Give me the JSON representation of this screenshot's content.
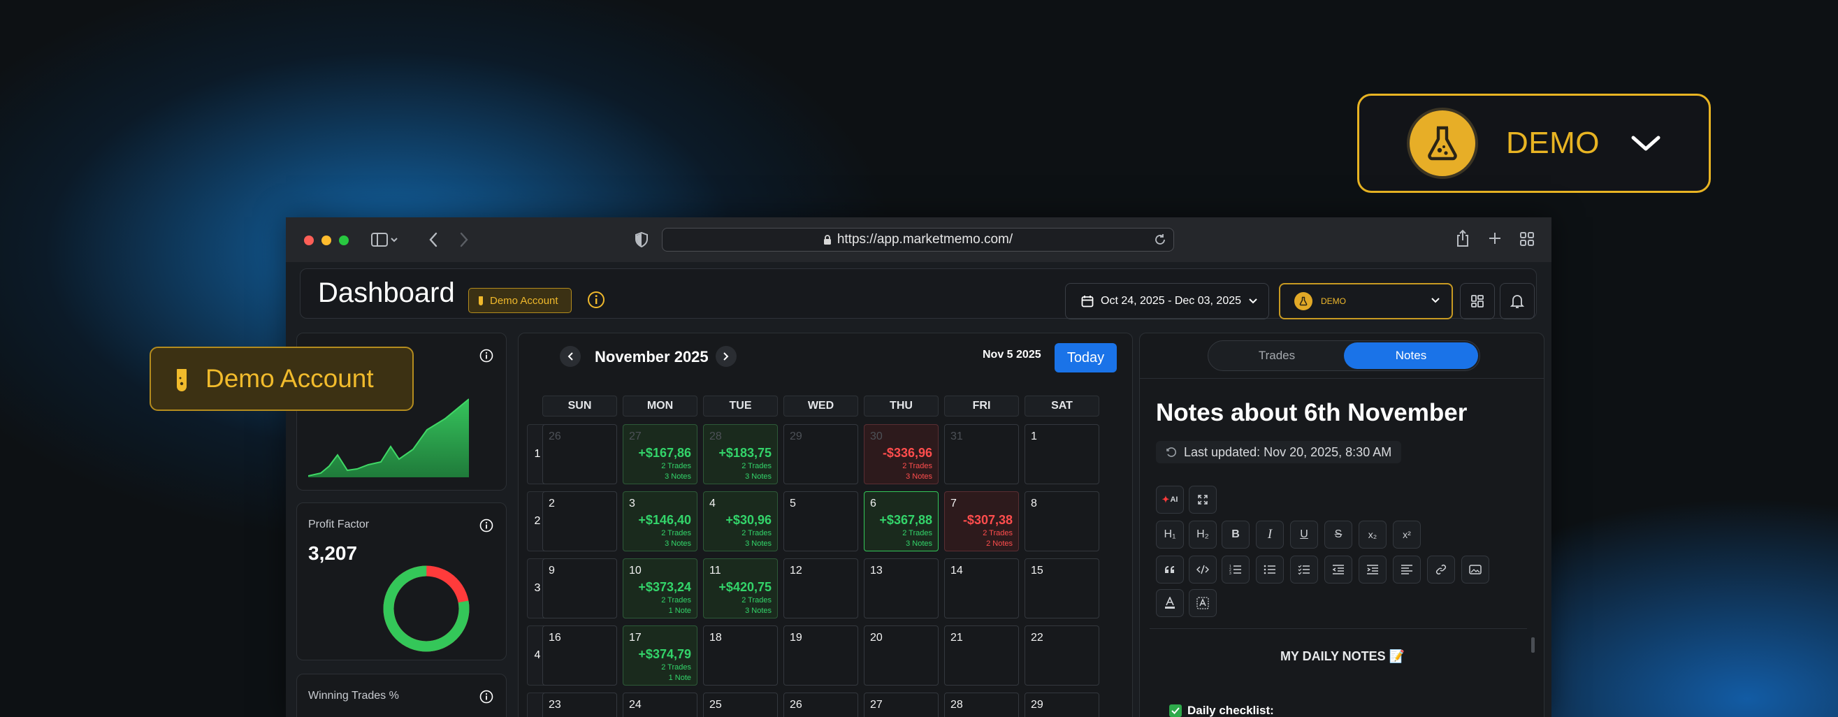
{
  "callouts": {
    "demo_label": "DEMO",
    "account_label": "Demo Account"
  },
  "browser": {
    "url": "https://app.marketmemo.com/"
  },
  "header": {
    "title": "Dashboard",
    "account_badge": "Demo Account",
    "date_range": "Oct 24, 2025 - Dec 03, 2025",
    "account_select": "DEMO"
  },
  "cards": {
    "profit_factor": {
      "label": "Profit Factor",
      "value": "3,207",
      "ratio_win": 0.78
    },
    "winning": {
      "label": "Winning Trades %"
    }
  },
  "calendar": {
    "month": "November 2025",
    "selected_date": "Nov 5 2025",
    "today_label": "Today",
    "days": [
      "SUN",
      "MON",
      "TUE",
      "WED",
      "THU",
      "FRI",
      "SAT"
    ],
    "weeks": [
      {
        "n": "1",
        "cells": [
          {
            "d": "26",
            "m": true
          },
          {
            "d": "27",
            "m": true,
            "pnl": "+$167,86",
            "tr": "2 Trades",
            "nt": "3 Notes",
            "s": "g"
          },
          {
            "d": "28",
            "m": true,
            "pnl": "+$183,75",
            "tr": "2 Trades",
            "nt": "3 Notes",
            "s": "g"
          },
          {
            "d": "29",
            "m": true
          },
          {
            "d": "30",
            "m": true,
            "pnl": "-$336,96",
            "tr": "2 Trades",
            "nt": "3 Notes",
            "s": "r"
          },
          {
            "d": "31",
            "m": true
          },
          {
            "d": "1"
          }
        ]
      },
      {
        "n": "2",
        "cells": [
          {
            "d": "2"
          },
          {
            "d": "3",
            "pnl": "+$146,40",
            "tr": "2 Trades",
            "nt": "3 Notes",
            "s": "g"
          },
          {
            "d": "4",
            "pnl": "+$30,96",
            "tr": "2 Trades",
            "nt": "3 Notes",
            "s": "g"
          },
          {
            "d": "5"
          },
          {
            "d": "6",
            "pnl": "+$367,88",
            "tr": "2 Trades",
            "nt": "3 Notes",
            "s": "g2"
          },
          {
            "d": "7",
            "pnl": "-$307,38",
            "tr": "2 Trades",
            "nt": "2 Notes",
            "s": "r"
          },
          {
            "d": "8"
          }
        ]
      },
      {
        "n": "3",
        "cells": [
          {
            "d": "9"
          },
          {
            "d": "10",
            "pnl": "+$373,24",
            "tr": "2 Trades",
            "nt": "1 Note",
            "s": "g"
          },
          {
            "d": "11",
            "pnl": "+$420,75",
            "tr": "2 Trades",
            "nt": "3 Notes",
            "s": "g"
          },
          {
            "d": "12"
          },
          {
            "d": "13"
          },
          {
            "d": "14"
          },
          {
            "d": "15"
          }
        ]
      },
      {
        "n": "4",
        "cells": [
          {
            "d": "16"
          },
          {
            "d": "17",
            "pnl": "+$374,79",
            "tr": "2 Trades",
            "nt": "1 Note",
            "s": "g"
          },
          {
            "d": "18"
          },
          {
            "d": "19"
          },
          {
            "d": "20"
          },
          {
            "d": "21"
          },
          {
            "d": "22"
          }
        ]
      },
      {
        "n": "5",
        "cells": [
          {
            "d": "23"
          },
          {
            "d": "24"
          },
          {
            "d": "25"
          },
          {
            "d": "26"
          },
          {
            "d": "27"
          },
          {
            "d": "28"
          },
          {
            "d": "29"
          }
        ]
      }
    ]
  },
  "notes": {
    "tabs": [
      "Trades",
      "Notes"
    ],
    "active_tab": 1,
    "title": "Notes about 6th November",
    "updated": "Last updated: Nov 20, 2025, 8:30 AM",
    "toolbar": {
      "ai": "AI",
      "h1": "H₁",
      "h2": "H₂",
      "bold": "B",
      "italic": "I",
      "underline": "U",
      "strike": "S",
      "sub": "x₂",
      "sup": "x²"
    },
    "daily_title": "MY DAILY NOTES 📝",
    "checklist": "Daily checklist:"
  },
  "colors": {
    "accent": "#1a73e8",
    "gold": "#e8b423",
    "profit": "#33d46a",
    "loss": "#ff4d4d"
  }
}
